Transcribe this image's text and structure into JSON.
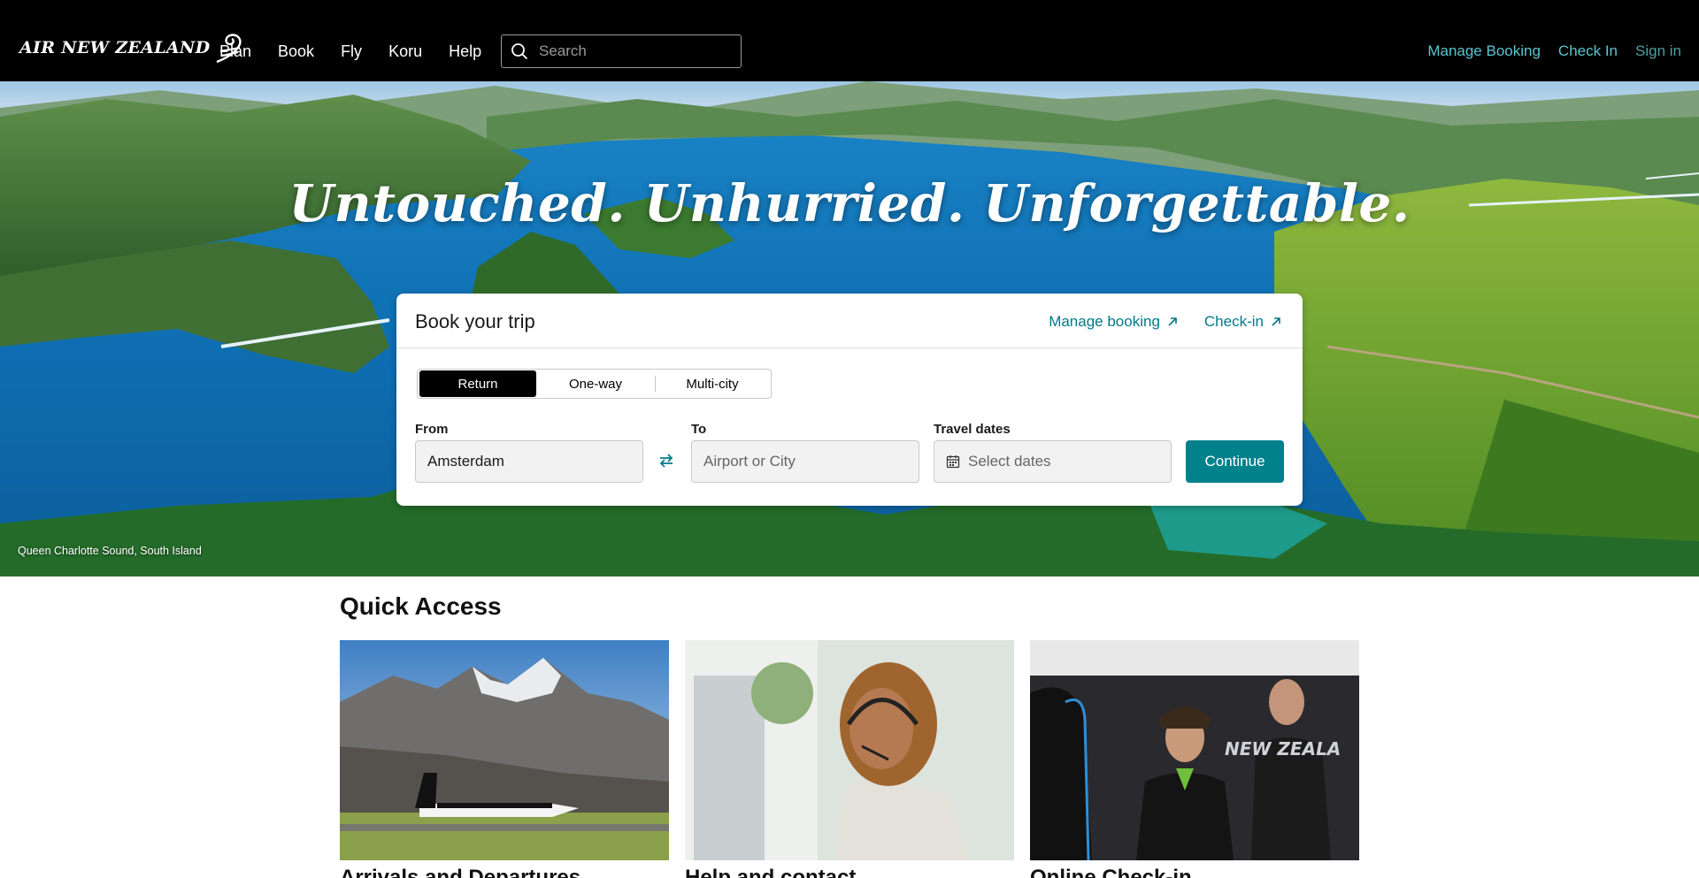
{
  "header": {
    "logo_text": "AIR NEW ZEALAND",
    "nav": [
      "Plan",
      "Book",
      "Fly",
      "Koru",
      "Help"
    ],
    "search_placeholder": "Search",
    "links": {
      "manage_booking": "Manage Booking",
      "check_in": "Check In",
      "sign_in": "Sign in"
    }
  },
  "hero": {
    "title": "Untouched. Unhurried. Unforgettable.",
    "caption": "Queen Charlotte Sound, South Island"
  },
  "booking": {
    "title": "Book your trip",
    "manage_link": "Manage booking",
    "checkin_link": "Check-in",
    "trip_types": [
      "Return",
      "One-way",
      "Multi-city"
    ],
    "selected_trip_type": "Return",
    "from_label": "From",
    "from_value": "Amsterdam",
    "to_label": "To",
    "to_placeholder": "Airport or City",
    "dates_label": "Travel dates",
    "dates_placeholder": "Select dates",
    "continue_label": "Continue"
  },
  "quick_access": {
    "title": "Quick Access",
    "tiles": [
      {
        "caption": "Arrivals and Departures"
      },
      {
        "caption": "Help and contact"
      },
      {
        "caption": "Online Check-in"
      }
    ]
  },
  "colors": {
    "header_bg": "#000000",
    "accent_teal": "#00818c",
    "link_teal": "#57c6cf"
  }
}
